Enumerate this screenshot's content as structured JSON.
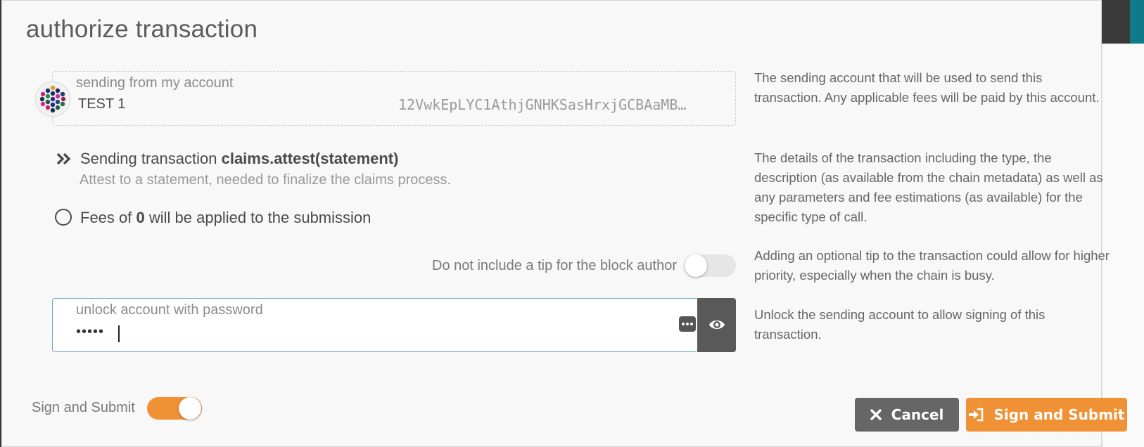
{
  "modal": {
    "title": "authorize transaction"
  },
  "account": {
    "label": "sending from my account",
    "name": "TEST 1",
    "address": "12VwkEpLYC1AthjGNHKSasHrxjGCBAaMB…",
    "help": "The sending account that will be used to send this transaction. Any applicable fees will be paid by this account."
  },
  "transaction": {
    "prefix": "Sending transaction",
    "call": "claims.attest(statement)",
    "description": "Attest to a statement, needed to finalize the claims process.",
    "fee_before": "Fees of",
    "fee_amount": "0",
    "fee_after": "will be applied to the submission",
    "help": "The details of the transaction including the type, the description (as available from the chain metadata) as well as any parameters and fee estimations (as available) for the specific type of call."
  },
  "tip": {
    "label": "Do not include a tip for the block author",
    "enabled": false,
    "help": "Adding an optional tip to the transaction could allow for higher priority, especially when the chain is busy."
  },
  "password": {
    "label": "unlock account with password",
    "masked_value": "•••••",
    "help": "Unlock the sending account to allow signing of this transaction."
  },
  "footer": {
    "sign_toggle_label": "Sign and Submit",
    "sign_toggle_enabled": true,
    "cancel_label": "Cancel",
    "submit_label": "Sign and Submit"
  },
  "colors": {
    "accent": "#f19135",
    "button_gray": "#666666",
    "focus_border": "#6aa5cc"
  },
  "icons": {
    "transaction": "double-chevron-right-icon",
    "fee": "circle-outline-icon",
    "password_manager": "more-dots-icon",
    "show_password": "eye-icon",
    "cancel": "close-icon",
    "submit": "sign-in-icon"
  }
}
